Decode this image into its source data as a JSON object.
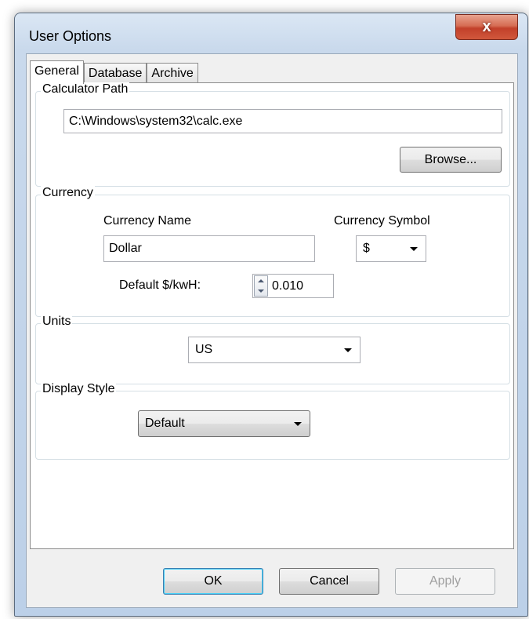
{
  "window": {
    "title": "User Options",
    "close_label": "x"
  },
  "tabs": [
    {
      "label": "General",
      "active": true
    },
    {
      "label": "Database",
      "active": false
    },
    {
      "label": "Archive",
      "active": false
    }
  ],
  "calculator": {
    "group_label": "Calculator Path",
    "path_value": "C:\\Windows\\system32\\calc.exe",
    "browse_label": "Browse..."
  },
  "currency": {
    "group_label": "Currency",
    "name_label": "Currency Name",
    "name_value": "Dollar",
    "symbol_label": "Currency Symbol",
    "symbol_value": "$",
    "rate_label": "Default $/kwH:",
    "rate_value": "0.010"
  },
  "units": {
    "group_label": "Units",
    "value": "US"
  },
  "display_style": {
    "group_label": "Display Style",
    "value": "Default"
  },
  "buttons": {
    "ok": "OK",
    "cancel": "Cancel",
    "apply": "Apply"
  },
  "colors": {
    "title_bar": "#bcd0e8",
    "close_button": "#c2402a",
    "default_button_border": "#3c7fb1"
  }
}
